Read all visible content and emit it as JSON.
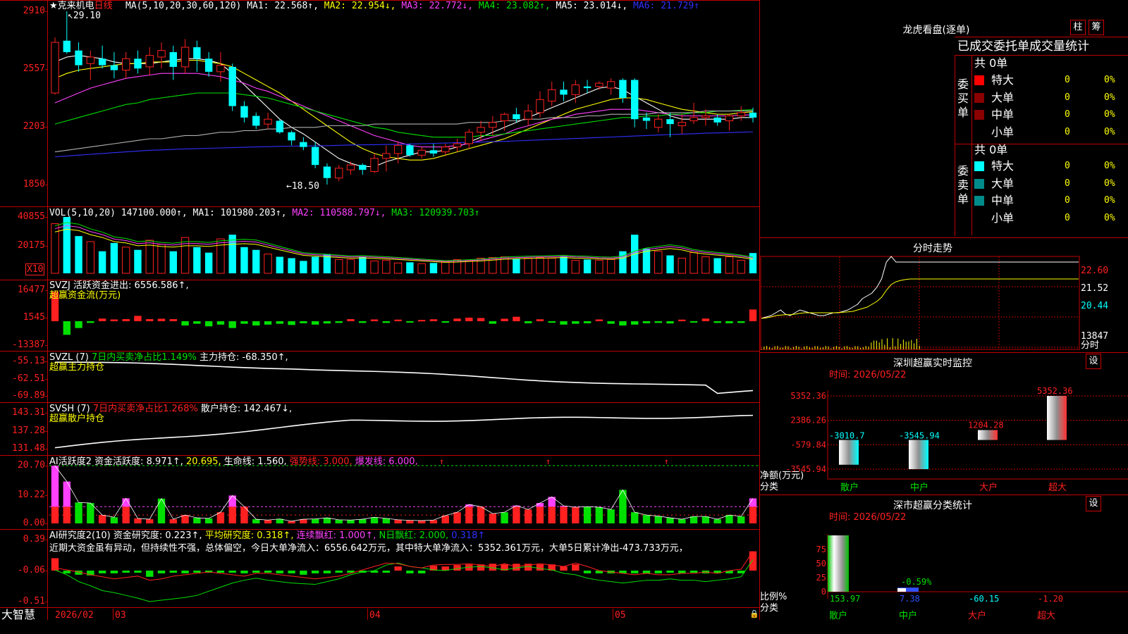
{
  "app": {
    "brand": "大智慧",
    "tools": [
      "柱",
      "筹"
    ]
  },
  "stock": {
    "name": "★克来机电",
    "period": "日线",
    "high_mark": "29.10",
    "low_mark": "18.50"
  },
  "colors": {
    "up": "#ff2020",
    "down": "#00ffff",
    "green": "#00e000",
    "yellow": "#ffff00",
    "magenta": "#ff40ff",
    "white": "#ffffff",
    "blue": "#3030ff",
    "axis": "#c00000"
  },
  "headers": {
    "price": [
      {
        "text": "MA(5,10,20,30,60,120)",
        "color": "#ffffff"
      },
      {
        "text": "MA1: 22.568↑,",
        "color": "#ffffff"
      },
      {
        "text": "MA2: 22.954↓,",
        "color": "#ffff00"
      },
      {
        "text": "MA3: 22.772↓,",
        "color": "#ff40ff"
      },
      {
        "text": "MA4: 23.082↑,",
        "color": "#00e000"
      },
      {
        "text": "MA5: 23.014↓,",
        "color": "#ffffff"
      },
      {
        "text": "MA6: 21.729↑",
        "color": "#3030ff"
      }
    ],
    "vol": [
      {
        "text": "VOL(5,10,20)",
        "color": "#ffffff"
      },
      {
        "text": "147100.000↑,",
        "color": "#ffffff"
      },
      {
        "text": "MA1: 101980.203↑,",
        "color": "#ffffff"
      },
      {
        "text": "MA2: 110588.797↓,",
        "color": "#ff40ff"
      },
      {
        "text": "MA3: 120939.703↑",
        "color": "#00e000"
      }
    ],
    "svzj": [
      {
        "text": "SVZJ  活跃资金进出: 6556.586↑,",
        "color": "#ffffff"
      }
    ],
    "svzl": [
      {
        "text": "SVZL (7)",
        "color": "#ffffff"
      },
      {
        "text": "7日内买卖净占比1.149%",
        "color": "#00e000"
      },
      {
        "text": "主力持仓: -68.350↑,",
        "color": "#ffffff"
      }
    ],
    "svsh": [
      {
        "text": "SVSH (7)",
        "color": "#ffffff"
      },
      {
        "text": "7日内买卖净占比1.268%",
        "color": "#ff2020"
      },
      {
        "text": "散户持仓: 142.467↓,",
        "color": "#ffffff"
      }
    ],
    "ai1": [
      {
        "text": "AI活跃度2 资金活跃度: 8.971↑,",
        "color": "#ffffff"
      },
      {
        "text": "20.695,",
        "color": "#ffff00"
      },
      {
        "text": "生命线: 1.560,",
        "color": "#ffffff"
      },
      {
        "text": "强势线: 3.000,",
        "color": "#ff2020"
      },
      {
        "text": "爆发线: 6.000,",
        "color": "#ff40ff"
      }
    ],
    "ai2": [
      {
        "text": "AI研究度2(10) 资金研究度: 0.223↑,",
        "color": "#ffffff"
      },
      {
        "text": "平均研究度: 0.318↑,",
        "color": "#ffff00"
      },
      {
        "text": "连续飘红: 1.000↑,",
        "color": "#ff40ff"
      },
      {
        "text": "N日飘红: 2.000,",
        "color": "#00e000"
      },
      {
        "text": "0.318↑",
        "color": "#3030ff"
      }
    ]
  },
  "sub_titles": {
    "svzj": "超赢资金流(万元)",
    "svzl": "超赢主力持仓",
    "svsh": "超赢散户持仓"
  },
  "ai_comment": "近期大资金虽有异动，但持续性不强，总体偏空，今日大单净流入：6556.642万元，其中特大单净流入：5352.361万元，大单5日累计净出-473.733万元，",
  "axes": {
    "price": [
      "2910",
      "2557",
      "2203",
      "1850"
    ],
    "vol": [
      "40855",
      "20175"
    ],
    "vol_unit": "X10",
    "svzj": [
      "16477",
      "1545",
      "-13387"
    ],
    "svzl": [
      "-55.13",
      "-62.51",
      "-69.89"
    ],
    "svsh": [
      "143.31",
      "137.28",
      "131.48"
    ],
    "ai1": [
      "20.70",
      "10.22",
      "0.00"
    ],
    "ai2": [
      "0.39",
      "-0.06",
      "-0.51"
    ],
    "dates": [
      "2026/02",
      "03",
      "04",
      "05"
    ]
  },
  "chart_data": {
    "type": "candlestick",
    "x_count": 60,
    "ohlc": [
      [
        24.1,
        27.5,
        24.0,
        27.2
      ],
      [
        27.3,
        29.1,
        26.5,
        26.6
      ],
      [
        26.7,
        27.2,
        25.4,
        25.8
      ],
      [
        25.9,
        26.7,
        24.9,
        26.3
      ],
      [
        26.2,
        27.0,
        25.6,
        25.8
      ],
      [
        25.8,
        26.6,
        25.0,
        25.5
      ],
      [
        25.5,
        26.6,
        25.0,
        26.2
      ],
      [
        26.2,
        26.7,
        25.3,
        25.6
      ],
      [
        25.7,
        26.9,
        25.2,
        26.4
      ],
      [
        26.3,
        27.2,
        25.6,
        26.7
      ],
      [
        26.6,
        27.0,
        24.9,
        25.7
      ],
      [
        25.7,
        27.4,
        25.3,
        26.9
      ],
      [
        26.9,
        27.3,
        25.4,
        26.2
      ],
      [
        26.2,
        26.6,
        25.1,
        25.4
      ],
      [
        25.4,
        26.6,
        24.8,
        25.8
      ],
      [
        25.7,
        25.9,
        23.0,
        23.3
      ],
      [
        23.3,
        23.6,
        22.3,
        22.6
      ],
      [
        22.7,
        22.9,
        21.9,
        22.1
      ],
      [
        22.2,
        22.9,
        21.9,
        22.5
      ],
      [
        22.4,
        22.5,
        21.6,
        21.7
      ],
      [
        21.7,
        21.8,
        20.9,
        21.2
      ],
      [
        21.1,
        21.4,
        20.6,
        20.8
      ],
      [
        20.8,
        21.1,
        19.5,
        19.7
      ],
      [
        19.6,
        19.8,
        18.5,
        18.9
      ],
      [
        18.9,
        19.7,
        18.7,
        19.5
      ],
      [
        19.4,
        19.9,
        19.1,
        19.7
      ],
      [
        19.7,
        19.8,
        19.1,
        19.4
      ],
      [
        19.3,
        20.4,
        19.2,
        20.1
      ],
      [
        20.1,
        20.9,
        19.3,
        20.4
      ],
      [
        20.4,
        21.1,
        19.8,
        20.9
      ],
      [
        20.9,
        21.0,
        20.2,
        20.3
      ],
      [
        20.3,
        20.8,
        20.1,
        20.6
      ],
      [
        20.6,
        21.0,
        20.2,
        20.4
      ],
      [
        20.5,
        21.0,
        20.3,
        20.8
      ],
      [
        20.8,
        21.3,
        20.5,
        21.0
      ],
      [
        21.0,
        21.9,
        20.7,
        21.7
      ],
      [
        21.7,
        22.4,
        21.2,
        22.0
      ],
      [
        22.0,
        22.7,
        21.5,
        22.3
      ],
      [
        22.4,
        22.9,
        21.8,
        22.8
      ],
      [
        22.8,
        23.2,
        22.3,
        22.5
      ],
      [
        22.5,
        23.4,
        22.1,
        23.0
      ],
      [
        22.9,
        24.2,
        22.6,
        23.7
      ],
      [
        23.6,
        24.8,
        23.3,
        24.3
      ],
      [
        24.3,
        24.8,
        23.6,
        24.0
      ],
      [
        24.0,
        24.9,
        23.5,
        24.6
      ],
      [
        24.5,
        24.9,
        24.1,
        24.4
      ],
      [
        24.5,
        24.8,
        24.3,
        24.7
      ],
      [
        24.4,
        25.0,
        24.0,
        24.8
      ],
      [
        24.9,
        25.0,
        23.5,
        23.8
      ],
      [
        24.9,
        25.0,
        22.0,
        22.5
      ],
      [
        22.6,
        22.9,
        21.9,
        22.4
      ],
      [
        22.0,
        22.8,
        21.7,
        22.5
      ],
      [
        22.5,
        22.9,
        21.4,
        22.2
      ],
      [
        22.1,
        22.8,
        21.6,
        22.3
      ],
      [
        22.4,
        23.5,
        22.2,
        22.6
      ],
      [
        22.6,
        23.1,
        22.1,
        22.7
      ],
      [
        22.6,
        22.8,
        22.1,
        22.3
      ],
      [
        22.4,
        22.8,
        21.8,
        22.7
      ],
      [
        22.7,
        23.3,
        22.4,
        22.9
      ],
      [
        22.9,
        23.2,
        22.3,
        22.6
      ]
    ],
    "ma": {
      "ma5": [
        26.0,
        26.3,
        26.4,
        26.3,
        26.2,
        26.0,
        25.9,
        25.9,
        25.9,
        26.0,
        26.1,
        26.2,
        26.2,
        26.1,
        25.9,
        25.3,
        24.6,
        23.9,
        23.2,
        22.5,
        22.0,
        21.6,
        21.1,
        20.6,
        20.1,
        19.8,
        19.6,
        19.6,
        19.9,
        20.1,
        20.3,
        20.5,
        20.5,
        20.6,
        20.8,
        21.1,
        21.4,
        21.7,
        22.0,
        22.3,
        22.6,
        22.9,
        23.2,
        23.5,
        23.8,
        24.1,
        24.4,
        24.5,
        24.3,
        23.9,
        23.5,
        23.1,
        22.7,
        22.5,
        22.5,
        22.5,
        22.5,
        22.5,
        22.6,
        22.6
      ],
      "ma10": [
        25.0,
        25.3,
        25.5,
        25.6,
        25.7,
        25.8,
        25.9,
        25.9,
        26.0,
        26.0,
        26.0,
        26.1,
        26.1,
        26.0,
        25.9,
        25.7,
        25.3,
        24.9,
        24.5,
        24.1,
        23.6,
        23.1,
        22.6,
        22.1,
        21.6,
        21.1,
        20.7,
        20.4,
        20.2,
        20.1,
        20.0,
        20.0,
        20.1,
        20.3,
        20.5,
        20.7,
        20.9,
        21.1,
        21.3,
        21.6,
        21.9,
        22.2,
        22.5,
        22.8,
        23.1,
        23.3,
        23.5,
        23.7,
        23.8,
        23.8,
        23.7,
        23.5,
        23.3,
        23.1,
        23.0,
        22.9,
        22.8,
        22.8,
        22.9,
        22.95
      ],
      "ma20": [
        23.5,
        23.8,
        24.1,
        24.4,
        24.6,
        24.8,
        25.0,
        25.1,
        25.2,
        25.3,
        25.3,
        25.3,
        25.3,
        25.2,
        25.1,
        24.9,
        24.7,
        24.4,
        24.2,
        23.9,
        23.6,
        23.3,
        23.0,
        22.7,
        22.4,
        22.1,
        21.8,
        21.5,
        21.3,
        21.1,
        20.9,
        20.8,
        20.8,
        20.8,
        20.9,
        21.0,
        21.2,
        21.4,
        21.6,
        21.9,
        22.1,
        22.3,
        22.5,
        22.6,
        22.8,
        22.9,
        23.0,
        23.1,
        23.1,
        23.1,
        23.0,
        22.9,
        22.8,
        22.7,
        22.7,
        22.7,
        22.7,
        22.7,
        22.75,
        22.77
      ],
      "ma30": [
        22.2,
        22.4,
        22.6,
        22.8,
        23.0,
        23.2,
        23.4,
        23.5,
        23.7,
        23.8,
        23.9,
        24.0,
        24.1,
        24.1,
        24.1,
        24.1,
        24.0,
        23.9,
        23.8,
        23.6,
        23.4,
        23.2,
        23.0,
        22.8,
        22.6,
        22.4,
        22.2,
        22.0,
        21.9,
        21.7,
        21.6,
        21.5,
        21.4,
        21.4,
        21.4,
        21.4,
        21.5,
        21.5,
        21.6,
        21.7,
        21.8,
        21.9,
        22.0,
        22.1,
        22.2,
        22.3,
        22.4,
        22.5,
        22.6,
        22.6,
        22.7,
        22.7,
        22.8,
        22.8,
        22.9,
        22.9,
        23.0,
        23.0,
        23.05,
        23.08
      ],
      "ma60": [
        20.5,
        20.6,
        20.7,
        20.8,
        20.9,
        21.0,
        21.1,
        21.2,
        21.3,
        21.3,
        21.4,
        21.5,
        21.5,
        21.6,
        21.7,
        21.7,
        21.8,
        21.8,
        21.9,
        21.9,
        22.0,
        22.0,
        22.0,
        22.1,
        22.1,
        22.1,
        22.1,
        22.2,
        22.2,
        22.2,
        22.2,
        22.2,
        22.2,
        22.2,
        22.2,
        22.3,
        22.3,
        22.3,
        22.4,
        22.4,
        22.5,
        22.5,
        22.6,
        22.6,
        22.6,
        22.7,
        22.7,
        22.8,
        22.8,
        22.8,
        22.8,
        22.9,
        22.9,
        22.9,
        22.9,
        23.0,
        23.0,
        23.0,
        23.0,
        23.01
      ],
      "ma120": [
        20.2,
        20.25,
        20.3,
        20.35,
        20.4,
        20.45,
        20.5,
        20.55,
        20.6,
        20.62,
        20.65,
        20.68,
        20.7,
        20.72,
        20.74,
        20.76,
        20.78,
        20.8,
        20.82,
        20.84,
        20.85,
        20.86,
        20.87,
        20.88,
        20.9,
        20.92,
        20.93,
        20.94,
        20.95,
        20.96,
        20.98,
        21.0,
        21.02,
        21.04,
        21.06,
        21.08,
        21.1,
        21.12,
        21.14,
        21.17,
        21.2,
        21.23,
        21.26,
        21.29,
        21.32,
        21.35,
        21.38,
        21.41,
        21.44,
        21.47,
        21.5,
        21.53,
        21.56,
        21.59,
        21.61,
        21.64,
        21.66,
        21.68,
        21.7,
        21.73
      ]
    },
    "volume": [
      36000,
      40855,
      27000,
      23000,
      16000,
      22000,
      19000,
      17000,
      24000,
      21000,
      16000,
      26000,
      19000,
      15000,
      25000,
      28000,
      19000,
      17000,
      14000,
      12000,
      11000,
      9000,
      12000,
      14000,
      10000,
      10000,
      12000,
      9000,
      9500,
      7500,
      8000,
      7000,
      7500,
      8500,
      10000,
      9000,
      11000,
      11500,
      12000,
      10500,
      11000,
      11500,
      11000,
      12500,
      9500,
      10000,
      9500,
      10000,
      16000,
      28000,
      18000,
      16000,
      13000,
      11000,
      15000,
      12000,
      11000,
      12000,
      9500,
      14710
    ],
    "vol_ma": [
      [
        30000,
        32000,
        31000,
        28000,
        26000,
        23000,
        22000,
        20000,
        20500,
        19500,
        19000,
        20000,
        20000,
        19500,
        20500,
        21000,
        21500,
        21000,
        19000,
        17000,
        15000,
        13000,
        12500,
        12000,
        11500,
        11000,
        11200,
        10800,
        10500,
        10000,
        9500,
        9000,
        8500,
        8000,
        8200,
        8600,
        9000,
        9600,
        10200,
        10600,
        10800,
        11000,
        11200,
        11400,
        11000,
        10800,
        10400,
        10200,
        11000,
        14000,
        16000,
        17000,
        18000,
        17000,
        15000,
        14000,
        13200,
        12500,
        11500,
        10198
      ]
    ],
    "svzj": [
      16477,
      -8000,
      -4000,
      -1000,
      1500,
      1000,
      1200,
      3000,
      1200,
      1400,
      1200,
      -2500,
      -1500,
      -3000,
      -2000,
      -4000,
      -1500,
      -2500,
      -2000,
      -1500,
      -2200,
      -1200,
      -2000,
      -1300,
      -1000,
      1200,
      -1000,
      1000,
      -1000,
      900,
      -800,
      700,
      1100,
      -900,
      1500,
      2000,
      1800,
      -1500,
      1400,
      2500,
      -1200,
      1100,
      -900,
      -2000,
      -1500,
      -1200,
      1000,
      -1500,
      -2500,
      -2000,
      -1200,
      -1000,
      -1300,
      900,
      -800,
      1500,
      -1000,
      -1200,
      -1000,
      6556
    ]
  },
  "dragon_panel": {
    "title": "龙虎看盘(逐单)",
    "subtitle": "已成交委托单成交量统计",
    "buy_label": "委买单",
    "sell_label": "委卖单",
    "total": "共 0单",
    "rows": [
      "特大",
      "大单",
      "中单",
      "小单"
    ],
    "zero": "0",
    "pct": "0%",
    "buy_colors": [
      "#ff0000",
      "#8b0000",
      "#8b0000",
      ""
    ],
    "sell_colors": [
      "#00ffff",
      "#008b8b",
      "#008b8b",
      ""
    ]
  },
  "intraday": {
    "title": "分时走势",
    "ticks": [
      "22.60",
      "21.52",
      "20.44",
      "13847"
    ],
    "unit": "分时",
    "price": [
      21.2,
      21.25,
      21.3,
      21.4,
      21.5,
      21.35,
      21.3,
      21.4,
      21.5,
      21.45,
      21.4,
      21.35,
      21.3,
      21.3,
      21.35,
      21.4,
      21.4,
      21.45,
      21.5,
      21.6,
      21.7,
      21.9,
      22.0,
      22.1,
      22.3,
      22.6,
      23.2,
      23.4,
      23.2,
      23.2,
      23.2,
      23.2,
      23.2,
      23.2
    ],
    "avg": [
      21.2,
      21.22,
      21.25,
      21.3,
      21.32,
      21.33,
      21.33,
      21.35,
      21.38,
      21.4,
      21.4,
      21.4,
      21.4,
      21.4,
      21.4,
      21.4,
      21.41,
      21.42,
      21.43,
      21.45,
      21.5,
      21.55,
      21.6,
      21.7,
      21.8,
      21.95,
      22.2,
      22.4,
      22.5,
      22.55,
      22.58,
      22.6,
      22.6,
      22.6
    ]
  },
  "monitor": {
    "title": "深圳超赢实时监控",
    "time": "时间: 2026/05/22",
    "ticks": [
      "5352.36",
      "2386.26",
      "-579.84",
      "-3545.94"
    ],
    "ylabel": "净额(万元)",
    "xlabel": "分类",
    "categories": [
      "散户",
      "中户",
      "大户",
      "超大"
    ],
    "values": [
      -3010.7,
      -3545.94,
      1204.28,
      5352.36
    ],
    "labels": [
      "-3010.7",
      "-3545.94",
      "1204.28",
      "5352.36"
    ],
    "settings": "设"
  },
  "classify": {
    "title": "深市超赢分类统计",
    "time": "时间: 2026/05/22",
    "ticks": [
      "75",
      "50",
      "25",
      "0"
    ],
    "ylabel": "比例%",
    "xlabel": "分类",
    "categories": [
      "散户",
      "中户",
      "大户",
      "超大"
    ],
    "values": [
      153.97,
      7.38,
      -60.15,
      -1.2
    ],
    "labels": [
      "153.97",
      "7.38",
      "-60.15",
      "-1.20"
    ],
    "bar_label": "-0.59%",
    "settings": "设"
  }
}
